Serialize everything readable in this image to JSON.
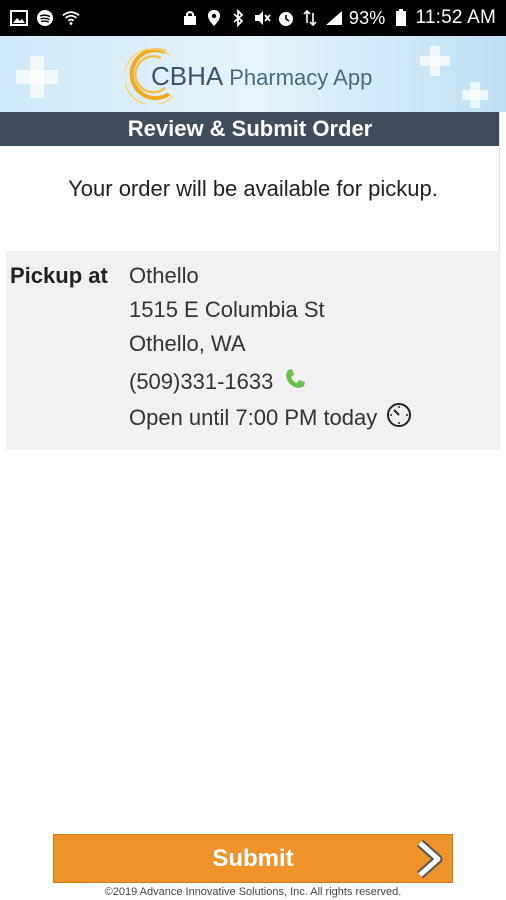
{
  "status_bar": {
    "battery": "93%",
    "time": "11:52 AM"
  },
  "app": {
    "brand": "CBHA",
    "name": "Pharmacy App"
  },
  "title": "Review & Submit Order",
  "notice": "Your order will be available for pickup.",
  "pickup": {
    "label": "Pickup at",
    "store": "Othello",
    "street": "1515 E Columbia St",
    "city": "Othello, WA",
    "phone": "(509)331-1633",
    "hours": "Open until 7:00 PM today"
  },
  "actions": {
    "submit_label": "Submit"
  },
  "footer": "©2019 Advance Innovative Solutions, Inc. All rights reserved.",
  "colors": {
    "accent": "#f0932a",
    "title_bar": "#3f4e5a",
    "phone_icon": "#6cc04a"
  }
}
